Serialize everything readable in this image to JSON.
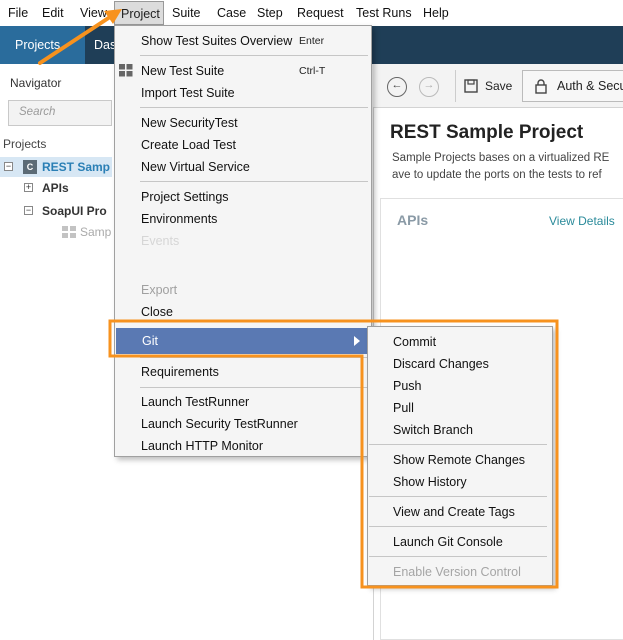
{
  "menubar": {
    "items": [
      "File",
      "Edit",
      "View",
      "Project",
      "Suite",
      "Case",
      "Step",
      "Request",
      "Test Runs",
      "Help"
    ]
  },
  "toolbar": {
    "projects_tab": "Projects",
    "das_tab": "Das"
  },
  "navigator": {
    "title": "Navigator",
    "search_placeholder": "Search",
    "projects_header": "Projects",
    "tree": {
      "rest_sample": "REST Samp",
      "apis": "APIs",
      "soapui": "SoapUI Pro",
      "sample": "Samp"
    }
  },
  "right_panel": {
    "save_label": "Save",
    "auth_label": "Auth & Secu",
    "project_title": "REST Sample Project",
    "description_line1": "Sample Projects bases on a virtualized RE",
    "description_line2": "ave to update the ports on the tests to ref",
    "apis_label": "APIs",
    "view_details": "View Details"
  },
  "project_menu": {
    "show_overview": "Show Test Suites Overview",
    "show_overview_shortcut": "Enter",
    "new_test_suite": "New Test Suite",
    "new_test_suite_shortcut": "Ctrl-T",
    "import_test_suite": "Import Test Suite",
    "new_security_test": "New SecurityTest",
    "create_load_test": "Create Load Test",
    "new_virtual_service": "New Virtual Service",
    "project_settings": "Project Settings",
    "environments": "Environments",
    "events": "Events",
    "export": "Export",
    "close": "Close",
    "git": "Git",
    "requirements": "Requirements",
    "launch_testrunner": "Launch TestRunner",
    "launch_security_testrunner": "Launch Security TestRunner",
    "launch_http_monitor": "Launch HTTP Monitor"
  },
  "git_menu": {
    "commit": "Commit",
    "discard_changes": "Discard Changes",
    "push": "Push",
    "pull": "Pull",
    "switch_branch": "Switch Branch",
    "show_remote_changes": "Show Remote Changes",
    "show_history": "Show History",
    "view_create_tags": "View and Create Tags",
    "launch_git_console": "Launch Git Console",
    "enable_version_control": "Enable Version Control"
  },
  "colors": {
    "accent_orange": "#f7921e",
    "menu_highlight": "#5a79b3",
    "toolbar_dark": "#1f3e57",
    "projects_tab": "#2a6c9c"
  }
}
